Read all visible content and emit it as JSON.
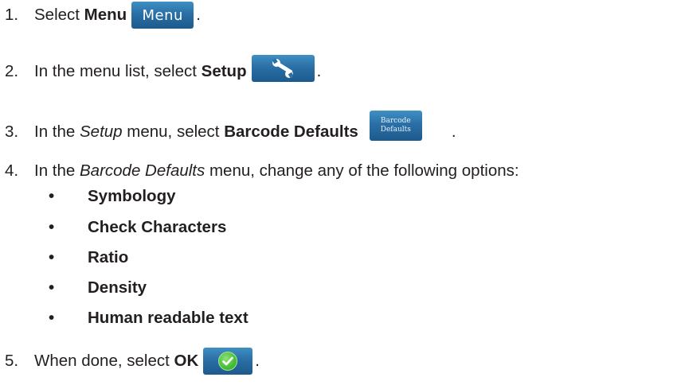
{
  "steps": [
    {
      "number": "1.",
      "prefix": "Select ",
      "bold": "Menu",
      "button_label": "Menu",
      "suffix": "."
    },
    {
      "number": "2.",
      "prefix": "In the menu list, select ",
      "bold": "Setup",
      "button_icon": "wrench-icon",
      "suffix": "."
    },
    {
      "number": "3.",
      "prefix": "In the ",
      "italic": "Setup",
      "middle": " menu, select ",
      "bold": "Barcode Defaults",
      "button_line1": "Barcode",
      "button_line2": "Defaults",
      "suffix": "."
    },
    {
      "number": "4.",
      "prefix": "In the ",
      "italic": "Barcode Defaults",
      "middle": " menu, change any of the following options:"
    },
    {
      "number": "5.",
      "prefix": "When done, select ",
      "bold": "OK",
      "button_icon": "check-icon",
      "suffix": "."
    }
  ],
  "options": [
    "Symbology",
    "Check Characters",
    "Ratio",
    "Density",
    "Human readable text"
  ],
  "bullet_char": "•",
  "colors": {
    "text": "#231f20",
    "button_blue": "#2a6fa6",
    "check_green": "#4cc13a"
  }
}
